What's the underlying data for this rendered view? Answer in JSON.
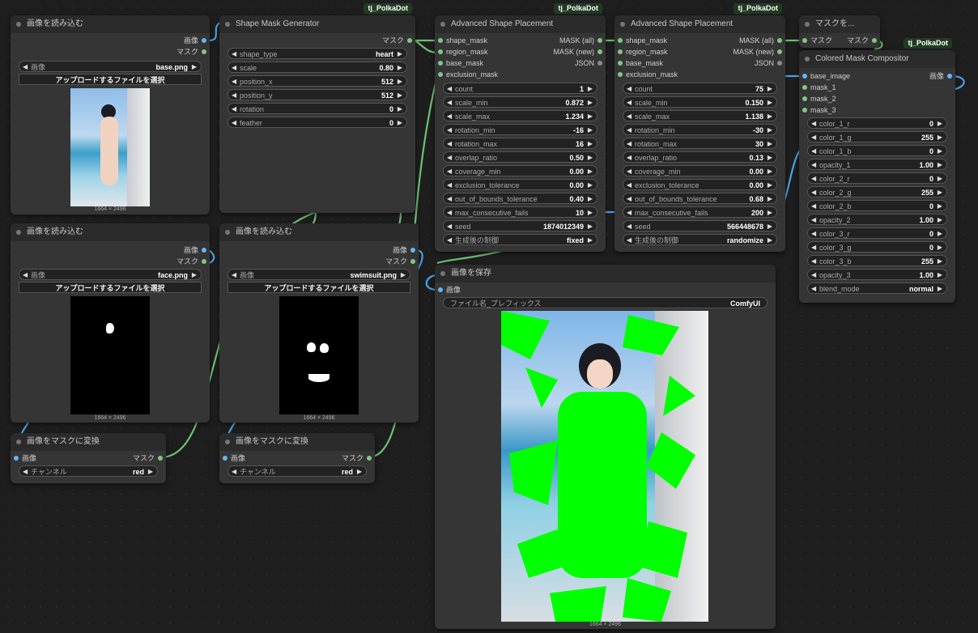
{
  "badge": "tj_PolkaDot",
  "load1": {
    "title": "画像を読み込む",
    "out_image": "画像",
    "out_mask": "マスク",
    "image_label": "画像",
    "image_value": "base.png",
    "upload": "アップロードするファイルを選択",
    "dims": "1664 × 2496"
  },
  "load2": {
    "title": "画像を読み込む",
    "out_image": "画像",
    "out_mask": "マスク",
    "image_label": "画像",
    "image_value": "face.png",
    "upload": "アップロードするファイルを選択",
    "dims": "1664 × 2496"
  },
  "load3": {
    "title": "画像を読み込む",
    "out_image": "画像",
    "out_mask": "マスク",
    "image_label": "画像",
    "image_value": "swimsuit.png",
    "upload": "アップロードするファイルを選択",
    "dims": "1664 × 2496"
  },
  "gen": {
    "title": "Shape Mask Generator",
    "out_mask": "マスク",
    "widgets": [
      {
        "label": "shape_type",
        "value": "heart"
      },
      {
        "label": "scale",
        "value": "0.80"
      },
      {
        "label": "position_x",
        "value": "512"
      },
      {
        "label": "position_y",
        "value": "512"
      },
      {
        "label": "rotation",
        "value": "0"
      },
      {
        "label": "feather",
        "value": "0"
      }
    ]
  },
  "asp1": {
    "title": "Advanced Shape Placement",
    "inputs": [
      "shape_mask",
      "region_mask",
      "base_mask",
      "exclusion_mask"
    ],
    "outputs": [
      "MASK (all)",
      "MASK (new)",
      "JSON"
    ],
    "widgets": [
      {
        "label": "count",
        "value": "1"
      },
      {
        "label": "scale_min",
        "value": "0.872"
      },
      {
        "label": "scale_max",
        "value": "1.234"
      },
      {
        "label": "rotation_min",
        "value": "-16"
      },
      {
        "label": "rotation_max",
        "value": "16"
      },
      {
        "label": "overlap_ratio",
        "value": "0.50"
      },
      {
        "label": "coverage_min",
        "value": "0.00"
      },
      {
        "label": "exclusion_tolerance",
        "value": "0.00"
      },
      {
        "label": "out_of_bounds_tolerance",
        "value": "0.40"
      },
      {
        "label": "max_consecutive_fails",
        "value": "10"
      },
      {
        "label": "seed",
        "value": "1874012349"
      },
      {
        "label": "生成後の制御",
        "value": "fixed"
      }
    ]
  },
  "asp2": {
    "title": "Advanced Shape Placement",
    "inputs": [
      "shape_mask",
      "region_mask",
      "base_mask",
      "exclusion_mask"
    ],
    "outputs": [
      "MASK (all)",
      "MASK (new)",
      "JSON"
    ],
    "widgets": [
      {
        "label": "count",
        "value": "75"
      },
      {
        "label": "scale_min",
        "value": "0.150"
      },
      {
        "label": "scale_max",
        "value": "1.138"
      },
      {
        "label": "rotation_min",
        "value": "-30"
      },
      {
        "label": "rotation_max",
        "value": "30"
      },
      {
        "label": "overlap_ratio",
        "value": "0.13"
      },
      {
        "label": "coverage_min",
        "value": "0.00"
      },
      {
        "label": "exclusion_tolerance",
        "value": "0.00"
      },
      {
        "label": "out_of_bounds_tolerance",
        "value": "0.68"
      },
      {
        "label": "max_consecutive_fails",
        "value": "200"
      },
      {
        "label": "seed",
        "value": "566448678"
      },
      {
        "label": "生成後の制御",
        "value": "randomize"
      }
    ]
  },
  "mask_node": {
    "title": "マスクを...",
    "in_mask": "マスク",
    "out_mask": "マスク"
  },
  "comp": {
    "title": "Colored Mask Compositor",
    "inputs": [
      "base_image",
      "mask_1",
      "mask_2",
      "mask_3"
    ],
    "out_image": "画像",
    "widgets": [
      {
        "label": "color_1_r",
        "value": "0"
      },
      {
        "label": "color_1_g",
        "value": "255"
      },
      {
        "label": "color_1_b",
        "value": "0"
      },
      {
        "label": "opacity_1",
        "value": "1.00"
      },
      {
        "label": "color_2_r",
        "value": "0"
      },
      {
        "label": "color_2_g",
        "value": "255"
      },
      {
        "label": "color_2_b",
        "value": "0"
      },
      {
        "label": "opacity_2",
        "value": "1.00"
      },
      {
        "label": "color_3_r",
        "value": "0"
      },
      {
        "label": "color_3_g",
        "value": "0"
      },
      {
        "label": "color_3_b",
        "value": "255"
      },
      {
        "label": "opacity_3",
        "value": "1.00"
      },
      {
        "label": "blend_mode",
        "value": "normal"
      }
    ]
  },
  "conv1": {
    "title": "画像をマスクに変換",
    "in_image": "画像",
    "out_mask": "マスク",
    "widget_label": "チャンネル",
    "widget_value": "red"
  },
  "conv2": {
    "title": "画像をマスクに変換",
    "in_image": "画像",
    "out_mask": "マスク",
    "widget_label": "チャンネル",
    "widget_value": "red"
  },
  "save": {
    "title": "画像を保存",
    "in_image": "画像",
    "prefix_label": "ファイル名_プレフィックス",
    "prefix_value": "ComfyUI",
    "dims": "1664 × 2496"
  },
  "colors": {
    "image_port": "#64b5f6",
    "mask_port": "#81c784",
    "wire_mask": "#6fbf73",
    "wire_image": "#4aa3e8",
    "accent_green": "#00ff00",
    "badge_bg": "#213b22"
  }
}
